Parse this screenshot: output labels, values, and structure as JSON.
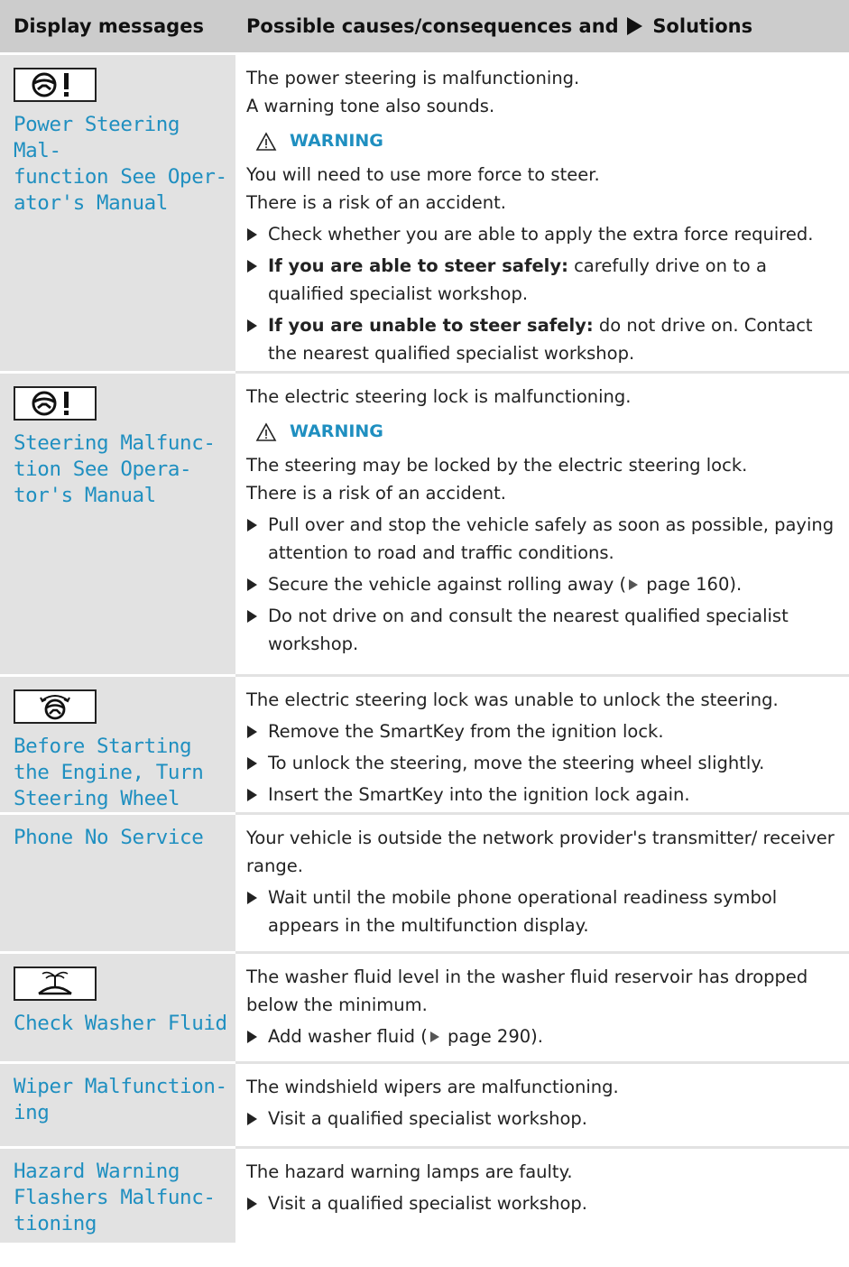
{
  "header": {
    "col1": "Display messages",
    "col2_prefix": "Possible causes/consequences and",
    "col2_suffix": "Solutions"
  },
  "colors": {
    "header_bg": "#cccccc",
    "left_col_bg": "#e2e2e2",
    "display_text": "#1f8fc0",
    "warning_text": "#1f8fc0"
  },
  "rows": [
    {
      "icon": "power-steering-warning-icon",
      "message": "Power Steering Mal-\nfunction See Oper-\nator's Manual",
      "intro": [
        "The power steering is malfunctioning.",
        "A warning tone also sounds."
      ],
      "warning_label": "WARNING",
      "warning_text": [
        "You will need to use more force to steer.",
        "There is a risk of an accident."
      ],
      "steps": [
        {
          "bold": "",
          "text": "Check whether you are able to apply the extra force required."
        },
        {
          "bold": "If you are able to steer safely:",
          "text": " carefully drive on to a qualified specialist workshop."
        },
        {
          "bold": "If you are unable to steer safely:",
          "text": " do not drive on. Contact the nearest qualified specialist workshop."
        }
      ]
    },
    {
      "icon": "steering-malfunction-warning-icon",
      "message": "Steering Malfunc-\ntion See Opera-\ntor's Manual",
      "intro": [
        "The electric steering lock is malfunctioning."
      ],
      "warning_label": "WARNING",
      "warning_text": [
        "The steering may be locked by the electric steering lock.",
        "There is a risk of an accident."
      ],
      "steps": [
        {
          "text": "Pull over and stop the vehicle safely as soon as possible, paying attention to road and traffic conditions."
        },
        {
          "text_before": "Secure the vehicle against rolling away (",
          "ref": "page 160",
          "text_after": ")."
        },
        {
          "text": "Do not drive on and consult the nearest qualified specialist workshop."
        }
      ]
    },
    {
      "icon": "turn-steering-wheel-icon",
      "message": "Before Starting\nthe Engine, Turn\nSteering Wheel",
      "intro": [
        "The electric steering lock was unable to unlock the steering."
      ],
      "steps": [
        {
          "text": "Remove the SmartKey from the ignition lock."
        },
        {
          "text": "To unlock the steering, move the steering wheel slightly."
        },
        {
          "text": "Insert the SmartKey into the ignition lock again."
        }
      ]
    },
    {
      "message": "Phone No Service",
      "intro": [
        "Your vehicle is outside the network provider's transmitter/ receiver range."
      ],
      "steps": [
        {
          "text": "Wait until the mobile phone operational readiness symbol appears in the multifunction display."
        }
      ]
    },
    {
      "icon": "washer-fluid-icon",
      "message": "Check Washer Fluid",
      "intro": [
        "The washer fluid level in the washer fluid reservoir has dropped below the minimum."
      ],
      "steps": [
        {
          "text_before": "Add washer fluid (",
          "ref": "page 290",
          "text_after": ")."
        }
      ]
    },
    {
      "message": "Wiper Malfunction-\ning",
      "intro": [
        "The windshield wipers are malfunctioning."
      ],
      "steps": [
        {
          "text": "Visit a qualified specialist workshop."
        }
      ]
    },
    {
      "message": "Hazard Warning\nFlashers Malfunc-\ntioning",
      "intro": [
        "The hazard warning lamps are faulty."
      ],
      "steps": [
        {
          "text": "Visit a qualified specialist workshop."
        }
      ]
    }
  ]
}
